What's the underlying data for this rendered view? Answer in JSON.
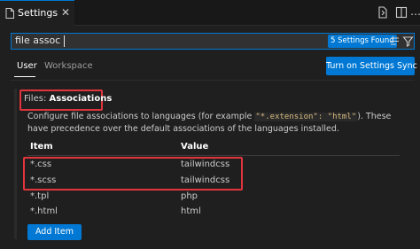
{
  "tab": {
    "label": "Settings",
    "close": "✕"
  },
  "toolbar": {
    "open_json_icon": "open-settings-json-icon",
    "split_icon": "split-editor-icon",
    "more": "…"
  },
  "search": {
    "value": "file assoc",
    "count": "5 Settings Found"
  },
  "scopes": {
    "user": "User",
    "workspace": "Workspace"
  },
  "sync_button": "Turn on Settings Sync",
  "setting": {
    "category": "Files:",
    "name": "Associations",
    "description_1": "Configure file associations to languages (for example ",
    "description_code_1": "\"*.extension\": \"html\"",
    "description_2": "). These have precedence over the default associations of the languages installed."
  },
  "table": {
    "headers": {
      "item": "Item",
      "value": "Value"
    },
    "rows": [
      {
        "item": "*.css",
        "value": "tailwindcss"
      },
      {
        "item": "*.scss",
        "value": "tailwindcss"
      },
      {
        "item": "*.tpl",
        "value": "php"
      },
      {
        "item": "*.html",
        "value": "html"
      }
    ]
  },
  "add_button": "Add Item",
  "colors": {
    "accent": "#0078d4",
    "highlight_box": "#e0353d",
    "background": "#1f1f1f"
  }
}
